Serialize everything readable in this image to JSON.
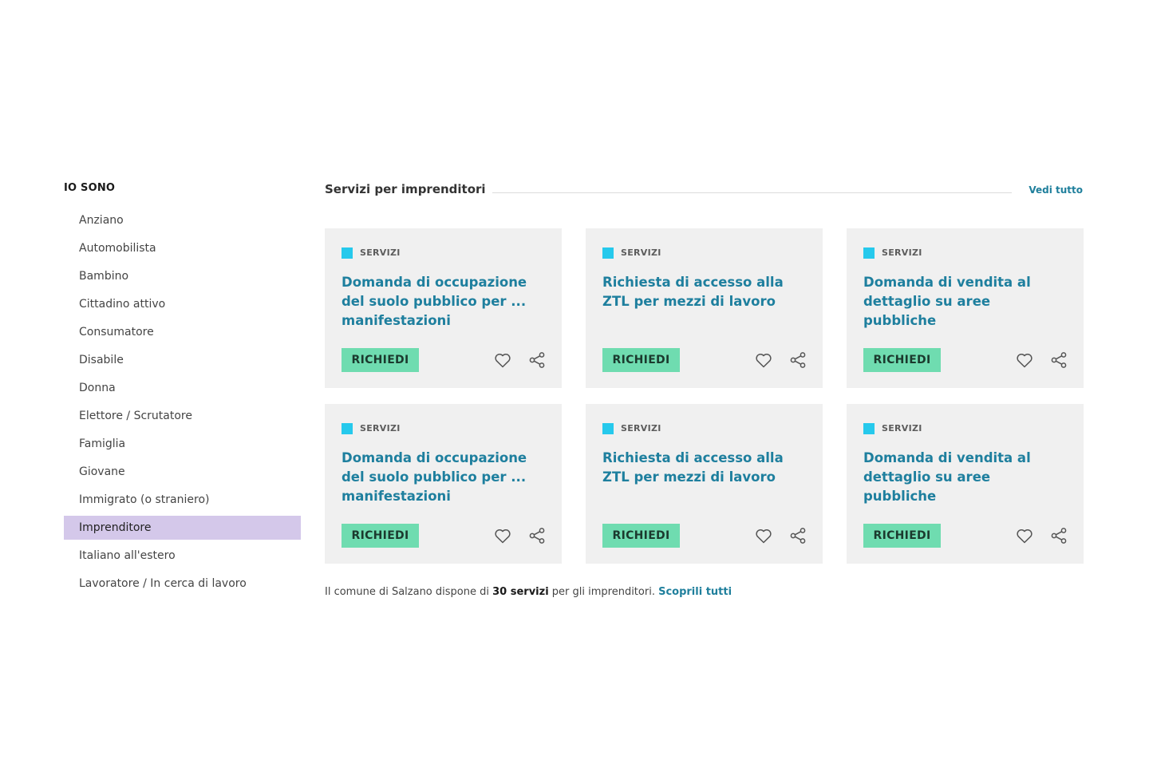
{
  "sidebar": {
    "title": "IO SONO",
    "items": [
      {
        "label": "Anziano"
      },
      {
        "label": "Automobilista"
      },
      {
        "label": "Bambino"
      },
      {
        "label": "Cittadino attivo"
      },
      {
        "label": "Consumatore"
      },
      {
        "label": "Disabile"
      },
      {
        "label": "Donna"
      },
      {
        "label": "Elettore / Scrutatore"
      },
      {
        "label": "Famiglia"
      },
      {
        "label": "Giovane"
      },
      {
        "label": "Immigrato (o straniero)"
      },
      {
        "label": "Imprenditore"
      },
      {
        "label": "Italiano all'estero"
      },
      {
        "label": "Lavoratore / In cerca di lavoro"
      }
    ],
    "active_item": "Imprenditore"
  },
  "section": {
    "title": "Servizi per imprenditori",
    "see_all": "Vedi tutto"
  },
  "cards": [
    {
      "category": "SERVIZI",
      "title": "Domanda di occupazione del suolo pubblico per ... manifestazioni",
      "button": "RICHIEDI"
    },
    {
      "category": "SERVIZI",
      "title": "Richiesta di accesso alla ZTL per mezzi di lavoro",
      "button": "RICHIEDI"
    },
    {
      "category": "SERVIZI",
      "title": "Domanda di vendita al dettaglio su aree pubbliche",
      "button": "RICHIEDI"
    },
    {
      "category": "SERVIZI",
      "title": "Domanda di occupazione del suolo pubblico per ... manifestazioni",
      "button": "RICHIEDI"
    },
    {
      "category": "SERVIZI",
      "title": "Richiesta di accesso alla ZTL per mezzi di lavoro",
      "button": "RICHIEDI"
    },
    {
      "category": "SERVIZI",
      "title": "Domanda di vendita al dettaglio su aree pubbliche",
      "button": "RICHIEDI"
    }
  ],
  "card_icons": {
    "favorite": "heart-icon",
    "share": "share-icon"
  },
  "summary": {
    "prefix": "Il comune di Salzano dispone di ",
    "count": "30 servizi",
    "suffix": " per gli imprenditori. ",
    "link": "Scoprili tutti"
  },
  "colors": {
    "active_item_bg": "#d4c8ea",
    "card_bg": "#f0f0f0",
    "category_square": "#26c9ec",
    "card_title": "#1e7f9e",
    "button_bg": "#6fdcb0",
    "link": "#1f7f9c"
  }
}
